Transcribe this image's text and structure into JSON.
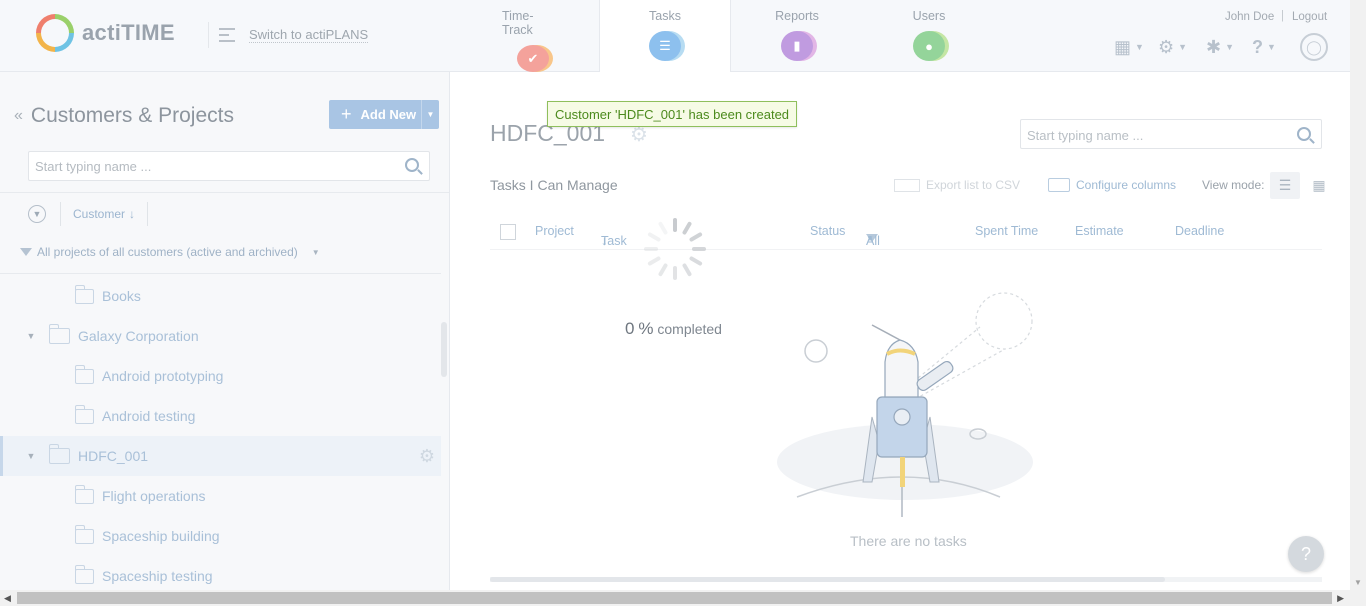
{
  "header": {
    "logo_text": "actiTIME",
    "switch_link": "Switch to actiPLANS",
    "nav": [
      {
        "label": "Time-Track",
        "icon": "check-icon",
        "color": "#f28b82"
      },
      {
        "label": "Tasks",
        "icon": "list-icon",
        "color": "#7ab5e8"
      },
      {
        "label": "Reports",
        "icon": "chart-icon",
        "color": "#b183d9"
      },
      {
        "label": "Users",
        "icon": "user-icon",
        "color": "#82cc8a"
      }
    ],
    "user_name": "John Doe",
    "separator": "|",
    "logout": "Logout"
  },
  "left_panel": {
    "title": "Customers & Projects",
    "add_new": "Add New",
    "search_placeholder": "Start typing name ...",
    "sort_label": "Customer",
    "project_filter": "All projects of all customers (active and archived)",
    "tree": [
      {
        "label": "Books",
        "type": "project"
      },
      {
        "label": "Galaxy Corporation",
        "type": "customer"
      },
      {
        "label": "Android prototyping",
        "type": "project"
      },
      {
        "label": "Android testing",
        "type": "project"
      },
      {
        "label": "HDFC_001",
        "type": "customer",
        "selected": true
      },
      {
        "label": "Flight operations",
        "type": "project"
      },
      {
        "label": "Spaceship building",
        "type": "project"
      },
      {
        "label": "Spaceship testing",
        "type": "project"
      }
    ]
  },
  "main": {
    "customer_title": "HDFC_001",
    "toast": "Customer 'HDFC_001' has been created",
    "search_placeholder": "Start typing name ...",
    "section_title": "Tasks I Can Manage",
    "export": "Export list to CSV",
    "configure": "Configure columns",
    "view_mode": "View mode:",
    "columns": {
      "project": "Project",
      "task": "Task",
      "status": "Status",
      "status_filter": "All",
      "spent": "Spent Time",
      "estimate": "Estimate",
      "deadline": "Deadline"
    },
    "progress_value": "0",
    "progress_unit": "%",
    "progress_label": "completed",
    "empty_text": "There are no tasks",
    "help": "?"
  }
}
